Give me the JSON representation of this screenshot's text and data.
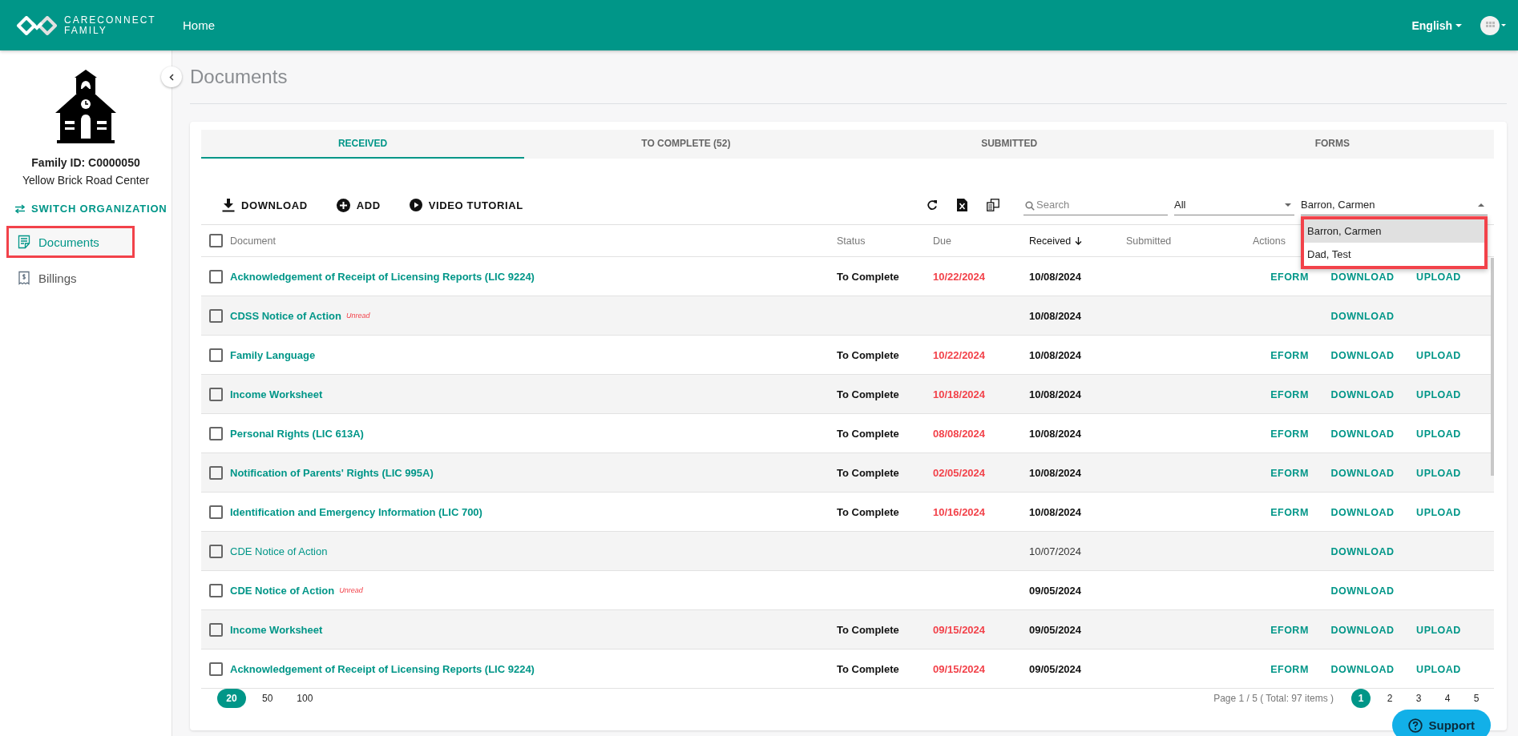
{
  "header": {
    "logo_line1": "CARECONNECT",
    "logo_line2": "FAMILY",
    "nav_link": "Home",
    "language": "English"
  },
  "sidebar": {
    "family_id": "Family ID: C0000050",
    "center": "Yellow Brick Road Center",
    "switch_label": "SWITCH ORGANIZATION",
    "items": [
      {
        "label": "Documents",
        "kind": "document",
        "selected": true,
        "highlighted": true
      },
      {
        "label": "Billings",
        "kind": "receipt",
        "selected": false,
        "highlighted": false
      }
    ]
  },
  "page_title": "Documents",
  "tabs": [
    {
      "label": "RECEIVED",
      "selected": true
    },
    {
      "label": "TO COMPLETE (52)",
      "selected": false
    },
    {
      "label": "SUBMITTED",
      "selected": false
    },
    {
      "label": "FORMS",
      "selected": false
    }
  ],
  "toolbar": {
    "buttons": [
      {
        "label": "DOWNLOAD",
        "kind": "download"
      },
      {
        "label": "ADD",
        "kind": "add"
      },
      {
        "label": "VIDEO TUTORIAL",
        "kind": "play"
      }
    ],
    "search": {
      "placeholder": "Search"
    },
    "status_filter": {
      "value": "All"
    },
    "person_filter": {
      "value": "Barron, Carmen",
      "expanded": true,
      "highlighted": true,
      "options": [
        {
          "label": "Barron, Carmen",
          "selected": true
        },
        {
          "label": "Dad, Test",
          "selected": false
        }
      ]
    }
  },
  "table": {
    "select_all_checked": false,
    "columns": [
      {
        "label": "Document",
        "sorted": false
      },
      {
        "label": "Status",
        "sorted": false
      },
      {
        "label": "Due",
        "sorted": false
      },
      {
        "label": "Received",
        "sorted": true
      },
      {
        "label": "Submitted",
        "sorted": false
      },
      {
        "label": "Actions",
        "sorted": false
      }
    ],
    "rows": [
      {
        "checked": false,
        "document": "Acknowledgement of Receipt of Licensing Reports (LIC 9224)",
        "viewed": false,
        "status": "To Complete",
        "due": "10/22/2024",
        "received": "10/08/2024",
        "eform": "EFORM",
        "download": "DOWNLOAD",
        "upload": "UPLOAD"
      },
      {
        "checked": false,
        "document": "CDSS Notice of Action",
        "unread_label": "Unread",
        "viewed": false,
        "received": "10/08/2024",
        "download": "DOWNLOAD"
      },
      {
        "checked": false,
        "document": "Family Language",
        "viewed": false,
        "status": "To Complete",
        "due": "10/22/2024",
        "received": "10/08/2024",
        "eform": "EFORM",
        "download": "DOWNLOAD",
        "upload": "UPLOAD"
      },
      {
        "checked": false,
        "document": "Income Worksheet",
        "viewed": false,
        "status": "To Complete",
        "due": "10/18/2024",
        "received": "10/08/2024",
        "eform": "EFORM",
        "download": "DOWNLOAD",
        "upload": "UPLOAD"
      },
      {
        "checked": false,
        "document": "Personal Rights (LIC 613A)",
        "viewed": false,
        "status": "To Complete",
        "due": "08/08/2024",
        "received": "10/08/2024",
        "eform": "EFORM",
        "download": "DOWNLOAD",
        "upload": "UPLOAD"
      },
      {
        "checked": false,
        "document": "Notification of Parents' Rights (LIC 995A)",
        "viewed": false,
        "status": "To Complete",
        "due": "02/05/2024",
        "received": "10/08/2024",
        "eform": "EFORM",
        "download": "DOWNLOAD",
        "upload": "UPLOAD"
      },
      {
        "checked": false,
        "document": "Identification and Emergency Information (LIC 700)",
        "viewed": false,
        "status": "To Complete",
        "due": "10/16/2024",
        "received": "10/08/2024",
        "eform": "EFORM",
        "download": "DOWNLOAD",
        "upload": "UPLOAD"
      },
      {
        "checked": false,
        "document": "CDE Notice of Action",
        "viewed": true,
        "received": "10/07/2024",
        "download": "DOWNLOAD"
      },
      {
        "checked": false,
        "document": "CDE Notice of Action",
        "unread_label": "Unread",
        "viewed": false,
        "received": "09/05/2024",
        "download": "DOWNLOAD"
      },
      {
        "checked": false,
        "document": "Income Worksheet",
        "viewed": false,
        "status": "To Complete",
        "due": "09/15/2024",
        "received": "09/05/2024",
        "eform": "EFORM",
        "download": "DOWNLOAD",
        "upload": "UPLOAD"
      },
      {
        "checked": false,
        "document": "Acknowledgement of Receipt of Licensing Reports (LIC 9224)",
        "viewed": false,
        "status": "To Complete",
        "due": "09/15/2024",
        "received": "09/05/2024",
        "eform": "EFORM",
        "download": "DOWNLOAD",
        "upload": "UPLOAD"
      }
    ]
  },
  "pagination": {
    "page_sizes": [
      {
        "label": "20",
        "selected": true
      },
      {
        "label": "50",
        "selected": false
      },
      {
        "label": "100",
        "selected": false
      }
    ],
    "summary": "Page 1 / 5 ( Total: 97 items )",
    "pages": [
      {
        "label": "1",
        "selected": true
      },
      {
        "label": "2",
        "selected": false
      },
      {
        "label": "3",
        "selected": false
      },
      {
        "label": "4",
        "selected": false
      },
      {
        "label": "5",
        "selected": false
      }
    ]
  },
  "support": "Support"
}
